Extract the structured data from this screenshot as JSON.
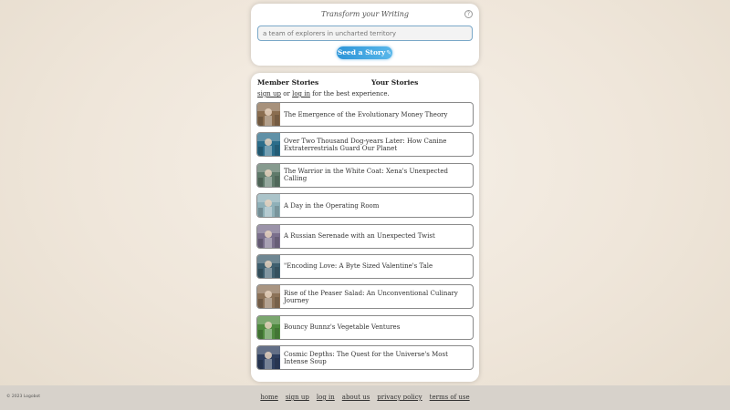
{
  "header": {
    "tagline": "Transform your Writing",
    "help_icon": "?",
    "prompt_placeholder": "a team of explorers in uncharted territory",
    "seed_button_label": "Seed a Story",
    "seed_button_icon": "quill-icon"
  },
  "tabs": {
    "member": "Member Stories",
    "yours": "Your Stories"
  },
  "auth_note": {
    "signup": "sign up",
    "or": "or",
    "login": "log in",
    "suffix": "for the best experience."
  },
  "stories": [
    {
      "title": "The Emergence of the Evolutionary Money Theory",
      "thumb_color": "#8a6d4f"
    },
    {
      "title": "Over Two Thousand Dog-years Later: How Canine Extraterrestrials Guard Our Planet",
      "thumb_color": "#2b6d8a"
    },
    {
      "title": "The Warrior in the White Coat: Xena's Unexpected Calling",
      "thumb_color": "#5f7a6a"
    },
    {
      "title": "A Day in the Operating Room",
      "thumb_color": "#8fb0b8"
    },
    {
      "title": "A Russian Serenade with an Unexpected Twist",
      "thumb_color": "#7a6f8c"
    },
    {
      "title": "\"Encoding Love: A Byte Sized Valentine's Tale",
      "thumb_color": "#3f5f6f"
    },
    {
      "title": "Rise of the Peaser Salad: An Unconventional Culinary Journey",
      "thumb_color": "#8c7258"
    },
    {
      "title": "Bouncy Bunnz's Vegetable Ventures",
      "thumb_color": "#4f8a3f"
    },
    {
      "title": "Cosmic Depths: The Quest for the Universe's Most Intense Soup",
      "thumb_color": "#2f3f5f"
    }
  ],
  "footer": {
    "copyright": "© 2023 Logobot",
    "links": [
      "home",
      "sign up",
      "log in",
      "about us",
      "privacy policy",
      "terms of use"
    ]
  },
  "colors": {
    "accent": "#2d95d8",
    "background": "#efe6da",
    "footer_bg": "#d7d2cb"
  }
}
